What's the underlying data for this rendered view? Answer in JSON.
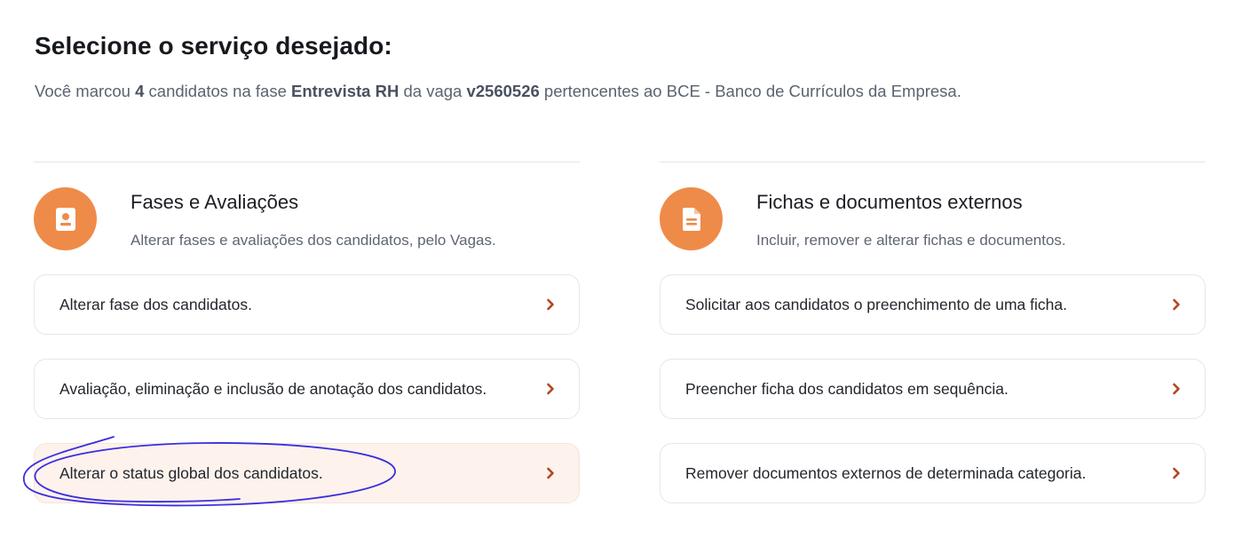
{
  "header": {
    "title": "Selecione o serviço desejado:",
    "subtitle_prefix": "Você marcou ",
    "count": "4",
    "subtitle_mid1": " candidatos na fase ",
    "phase": "Entrevista RH",
    "subtitle_mid2": " da vaga ",
    "vaga": "v2560526",
    "subtitle_suffix": " pertencentes ao BCE - Banco de Currículos da Empresa."
  },
  "sections": [
    {
      "title": "Fases e Avaliações",
      "description": "Alterar fases e avaliações dos candidatos, pelo Vagas.",
      "icon": "id-badge-icon",
      "items": [
        {
          "label": "Alterar fase dos candidatos."
        },
        {
          "label": "Avaliação, eliminação e inclusão de anotação dos candidatos."
        },
        {
          "label": "Alterar o status global dos candidatos."
        }
      ]
    },
    {
      "title": "Fichas e documentos externos",
      "description": "Incluir, remover e alterar fichas e documentos.",
      "icon": "document-icon",
      "items": [
        {
          "label": "Solicitar aos candidatos o preenchimento de uma ficha."
        },
        {
          "label": "Preencher ficha dos candidatos em sequência."
        },
        {
          "label": "Remover documentos externos de determinada categoria."
        }
      ]
    }
  ],
  "colors": {
    "accent": "#ef8b49",
    "chevron": "#b4441e",
    "highlight_bg": "#fdf2ec",
    "annotation": "#3a2ee0"
  }
}
